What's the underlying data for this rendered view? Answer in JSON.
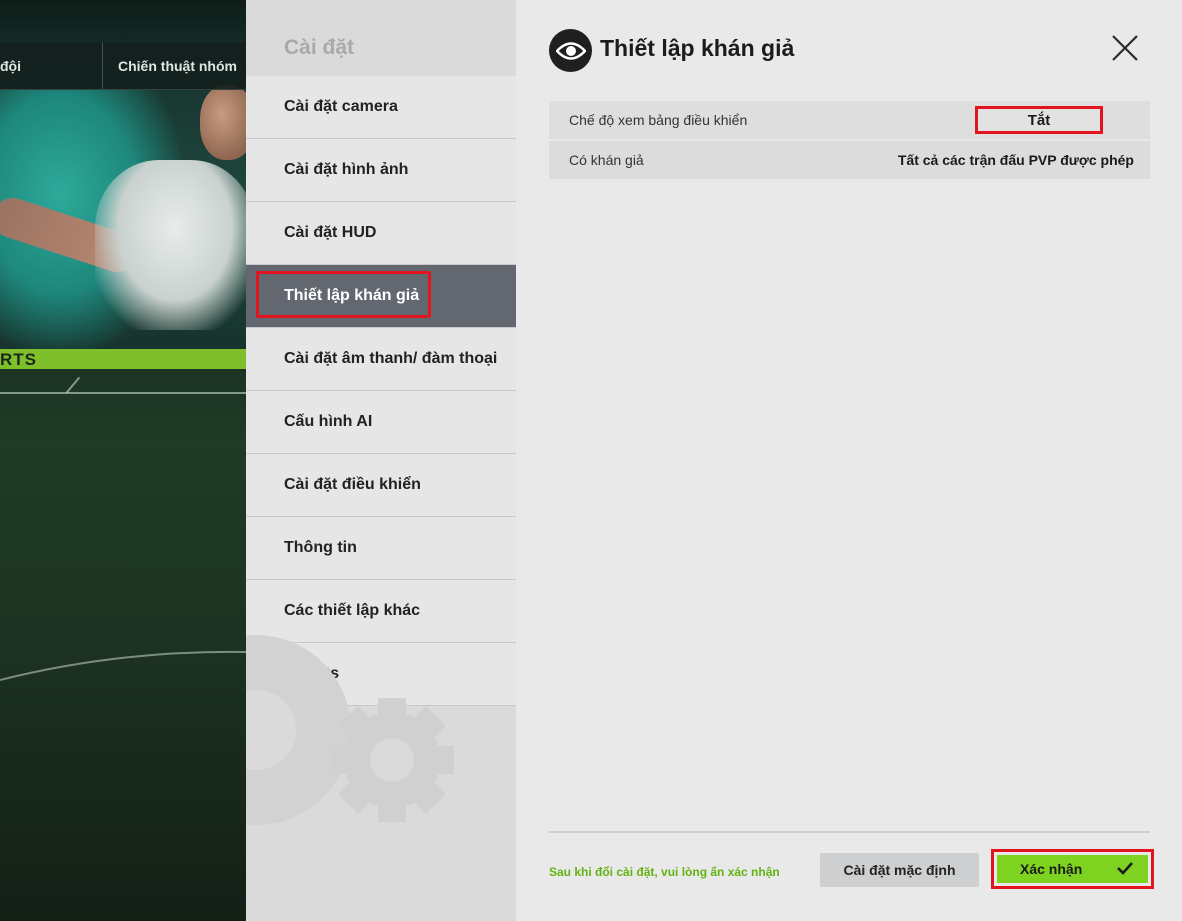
{
  "background": {
    "nav_tab_left": "đội",
    "nav_tab_right": "Chiến thuật nhóm",
    "ad_board_text": "RTS"
  },
  "sidebar": {
    "title": "Cài đặt",
    "items": [
      {
        "label": "Cài đặt camera",
        "icon": ""
      },
      {
        "label": "Cài đặt hình ảnh",
        "icon": ""
      },
      {
        "label": "Cài đặt HUD",
        "icon": ""
      },
      {
        "label": "Thiết lập khán giả",
        "icon": "",
        "active": true
      },
      {
        "label": "Cài đặt âm thanh/ đàm thoại",
        "icon": ""
      },
      {
        "label": "Cấu hình AI",
        "icon": ""
      },
      {
        "label": "Cài đặt điều khiển",
        "icon": ""
      },
      {
        "label": "Thông tin",
        "icon": ""
      },
      {
        "label": "Các thiết lập khác",
        "icon": ""
      },
      {
        "label": "Credits",
        "icon": ""
      }
    ],
    "decor_icon": "gear-icon"
  },
  "panel": {
    "icon": "eye-icon",
    "title": "Thiết lập khán giả",
    "close_icon": "close-icon",
    "rows": [
      {
        "label": "Chế độ xem bảng điều khiển",
        "value": "Tắt"
      },
      {
        "label": "Có khán giả",
        "value": "Tất cả các trận đấu PVP được phép"
      }
    ]
  },
  "footer": {
    "note": "Sau khi đổi cài đặt, vui lòng ấn xác nhận",
    "reset_label": "Cài đặt mặc định",
    "confirm_label": "Xác nhận",
    "confirm_icon": "check-icon"
  },
  "colors": {
    "highlight_red": "#e2141d",
    "confirm_green": "#7ed321",
    "note_green": "#63b313",
    "active_item": "#636870"
  }
}
